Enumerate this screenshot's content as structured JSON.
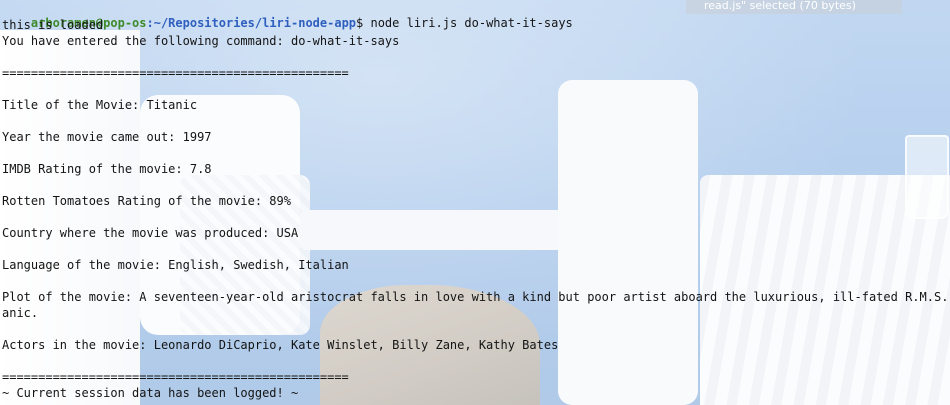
{
  "overlay": {
    "tooltip_text": "read.js\" selected (70 bytes)"
  },
  "terminal": {
    "prompt_user_host": "arboramen@pop-os",
    "prompt_path": ":~/Repositories/liri-node-app",
    "prompt_symbol": "$",
    "command": " node liri.js do-what-it-says",
    "lines": [
      "this is loaded",
      "You have entered the following command: do-what-it-says",
      "",
      "================================================",
      "",
      "Title of the Movie: Titanic",
      "",
      "Year the movie came out: 1997",
      "",
      "IMDB Rating of the movie: 7.8",
      "",
      "Rotten Tomatoes Rating of the movie: 89%",
      "",
      "Country where the movie was produced: USA",
      "",
      "Language of the movie: English, Swedish, Italian",
      "",
      "Plot of the movie: A seventeen-year-old aristocrat falls in love with a kind but poor artist aboard the luxurious, ill-fated R.M.S. Tit",
      "anic.",
      "",
      "Actors in the movie: Leonardo DiCaprio, Kate Winslet, Billy Zane, Kathy Bates",
      "",
      "================================================",
      "~ Current session data has been logged! ~"
    ]
  }
}
